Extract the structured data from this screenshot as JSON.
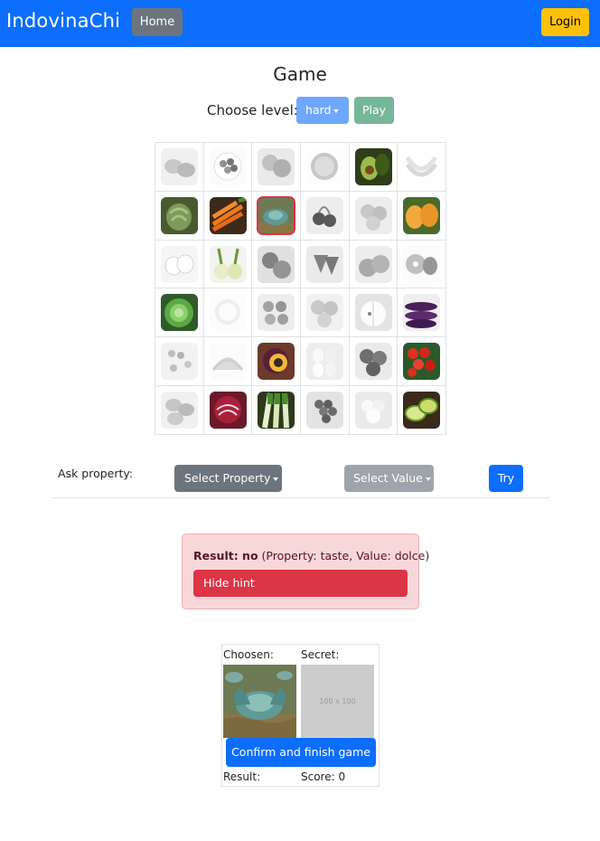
{
  "navbar": {
    "brand": "IndovinaChi",
    "home_label": "Home",
    "login_label": "Login"
  },
  "page": {
    "title": "Game"
  },
  "level": {
    "label": "Choose level:",
    "selected": "hard",
    "play_label": "Play"
  },
  "grid": {
    "cells": [
      {
        "name": "shellfish",
        "active": false
      },
      {
        "name": "olives",
        "active": false
      },
      {
        "name": "mandarins",
        "active": false
      },
      {
        "name": "orange",
        "active": false
      },
      {
        "name": "avocado",
        "active": true
      },
      {
        "name": "bananas",
        "active": false
      },
      {
        "name": "artichoke",
        "active": true
      },
      {
        "name": "carrots",
        "active": true
      },
      {
        "name": "cabbage",
        "active": true,
        "selected": true
      },
      {
        "name": "cherries",
        "active": false
      },
      {
        "name": "apricots",
        "active": false
      },
      {
        "name": "kiwano",
        "active": true
      },
      {
        "name": "garlic",
        "active": false
      },
      {
        "name": "fennel",
        "active": true
      },
      {
        "name": "tomatoes",
        "active": false
      },
      {
        "name": "strawberries",
        "active": false
      },
      {
        "name": "persimmons",
        "active": false
      },
      {
        "name": "kiwi",
        "active": false
      },
      {
        "name": "lettuce",
        "active": true
      },
      {
        "name": "lemon",
        "active": false
      },
      {
        "name": "nuts",
        "active": false
      },
      {
        "name": "peaches",
        "active": false
      },
      {
        "name": "apple",
        "active": false
      },
      {
        "name": "eggplant",
        "active": true
      },
      {
        "name": "peas",
        "active": false
      },
      {
        "name": "melon",
        "active": false
      },
      {
        "name": "passion-fruit",
        "active": true
      },
      {
        "name": "eggs",
        "active": false
      },
      {
        "name": "plums",
        "active": false
      },
      {
        "name": "cherry-tomatoes",
        "active": true
      },
      {
        "name": "potatoes",
        "active": false
      },
      {
        "name": "radicchio",
        "active": true
      },
      {
        "name": "leeks",
        "active": true
      },
      {
        "name": "grapes",
        "active": false
      },
      {
        "name": "cauliflower",
        "active": false
      },
      {
        "name": "lime",
        "active": true
      }
    ]
  },
  "ask": {
    "label": "Ask property:",
    "property_label": "Select Property",
    "value_label": "Select Value",
    "try_label": "Try"
  },
  "alert": {
    "result_label": "Result: no",
    "detail": "(Property: taste, Value: dolce)",
    "hint_button": "Hide hint"
  },
  "result": {
    "chosen_label": "Choosen:",
    "secret_label": "Secret:",
    "secret_placeholder": "100 x 100",
    "confirm_label": "Confirm and finish game",
    "result_label": "Result:",
    "score_label": "Score: 0"
  },
  "colors": {
    "primary": "#0d6efd",
    "secondary": "#6c757d",
    "warning": "#ffc107",
    "danger": "#dc3545",
    "alert_bg": "#f8d7da"
  }
}
